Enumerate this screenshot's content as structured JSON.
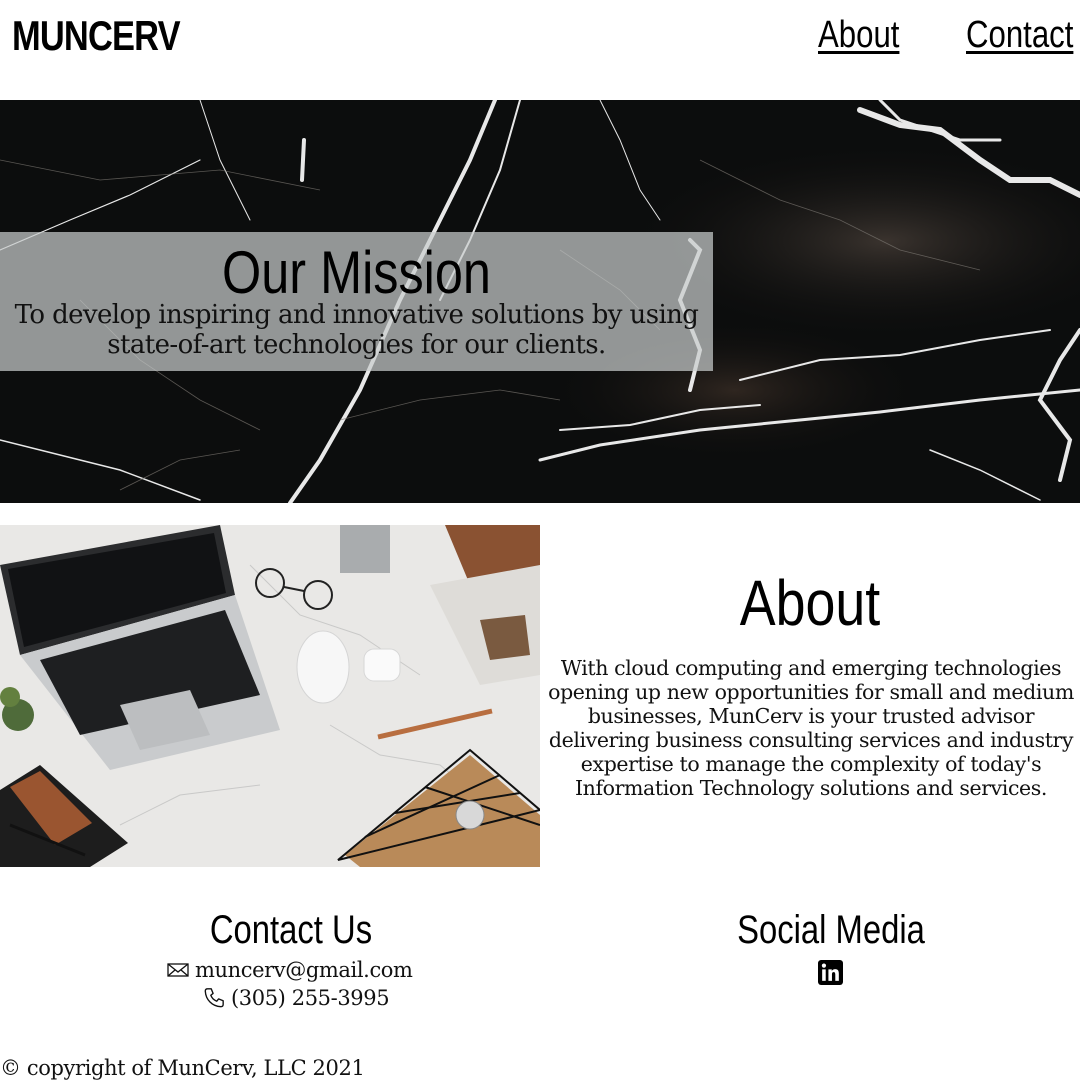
{
  "header": {
    "logo": "MUNCERV",
    "nav": [
      {
        "label": "About"
      },
      {
        "label": "Contact"
      }
    ]
  },
  "mission": {
    "title": "Our Mission",
    "text": "To develop inspiring and innovative solutions by using state-of-art technologies for our clients."
  },
  "about": {
    "title": "About",
    "text": "With cloud computing and emerging technologies opening up new opportunities for small and medium businesses, MunCerv is your trusted advisor delivering business consulting services and industry expertise to manage the complexity of today's Information Technology solutions and services."
  },
  "contact": {
    "title": "Contact Us",
    "email": "muncerv@gmail.com",
    "phone": "(305) 255-3995",
    "email_icon": "envelope-icon",
    "phone_icon": "phone-icon"
  },
  "social": {
    "title": "Social Media",
    "icon": "linkedin-icon"
  },
  "footer": {
    "copyright": "© copyright of MunCerv, LLC 2021"
  },
  "colors": {
    "text": "#000000",
    "hero_bg": "#0b0c0c",
    "mission_box": "#c8cccc"
  }
}
